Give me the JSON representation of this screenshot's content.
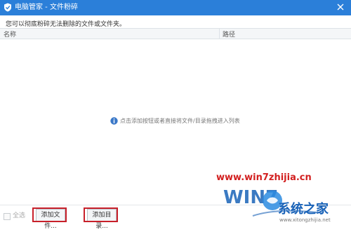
{
  "window": {
    "title": "电脑管家 - 文件粉碎",
    "close_label": "close"
  },
  "description": "您可以彻底粉碎无法删除的文件或文件夹。",
  "table": {
    "columns": [
      "名称",
      "路径"
    ],
    "rows": []
  },
  "empty_hint": "点击添加按钮或者直接将文件/目录拖拽进入列表",
  "footer": {
    "select_all_label": "全选",
    "add_file_label": "添加文件...",
    "add_dir_label": "添加目录..."
  },
  "watermark": {
    "url": "www.win7zhijia.cn",
    "logo_text": "系统之家",
    "sub_text": "www.xitongzhijia.net"
  },
  "colors": {
    "titlebar": "#2b7fd9",
    "highlight": "#c8202a"
  }
}
